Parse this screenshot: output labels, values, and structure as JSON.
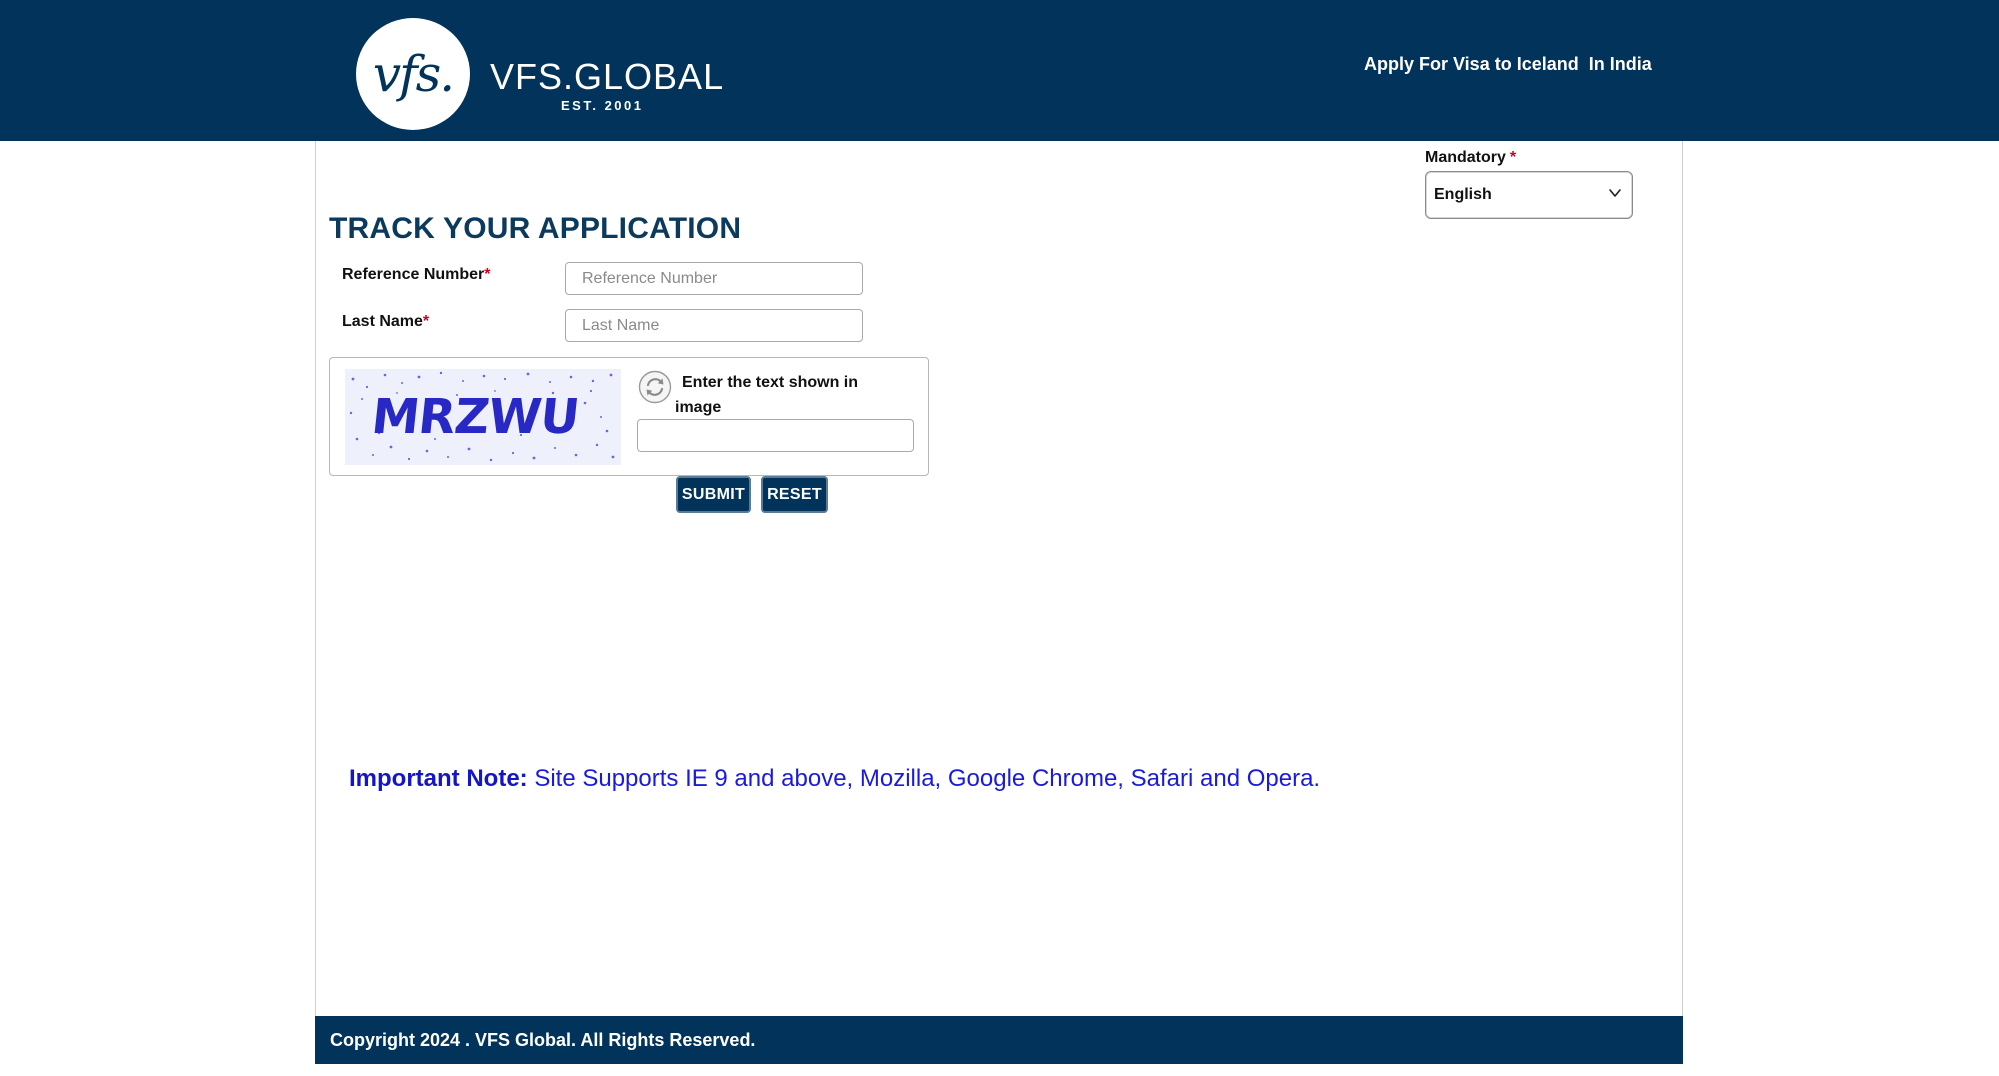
{
  "header": {
    "logo_mark": "vfs.",
    "logo_word": "VFS.GLOBAL",
    "logo_est": "EST. 2001",
    "link_text": "Apply For Visa to Iceland  In India"
  },
  "language": {
    "label": "Mandatory",
    "required_mark": "*",
    "selected": "English"
  },
  "form": {
    "title": "TRACK YOUR APPLICATION",
    "reference": {
      "label": "Reference Number",
      "required_mark": "*",
      "placeholder": "Reference Number",
      "value": ""
    },
    "last_name": {
      "label": "Last Name",
      "required_mark": "*",
      "placeholder": "Last Name",
      "value": ""
    },
    "captcha": {
      "image_text": "MRZWU",
      "prompt_line1": "Enter the text shown in",
      "prompt_line2": "image",
      "value": ""
    },
    "submit_label": "SUBMIT",
    "reset_label": "RESET"
  },
  "note": {
    "label": "Important Note:",
    "text": " Site Supports IE 9 and above, Mozilla, Google Chrome, Safari and Opera."
  },
  "footer": {
    "text": "Copyright 2024 . VFS Global. All Rights Reserved."
  },
  "colors": {
    "brand_navy": "#02335a",
    "title_navy": "#0b3a5d",
    "required_red": "#d0021b",
    "note_blue": "#1a1adb"
  },
  "icons": {
    "refresh": "refresh-icon",
    "dropdown": "chevron-down-icon"
  }
}
